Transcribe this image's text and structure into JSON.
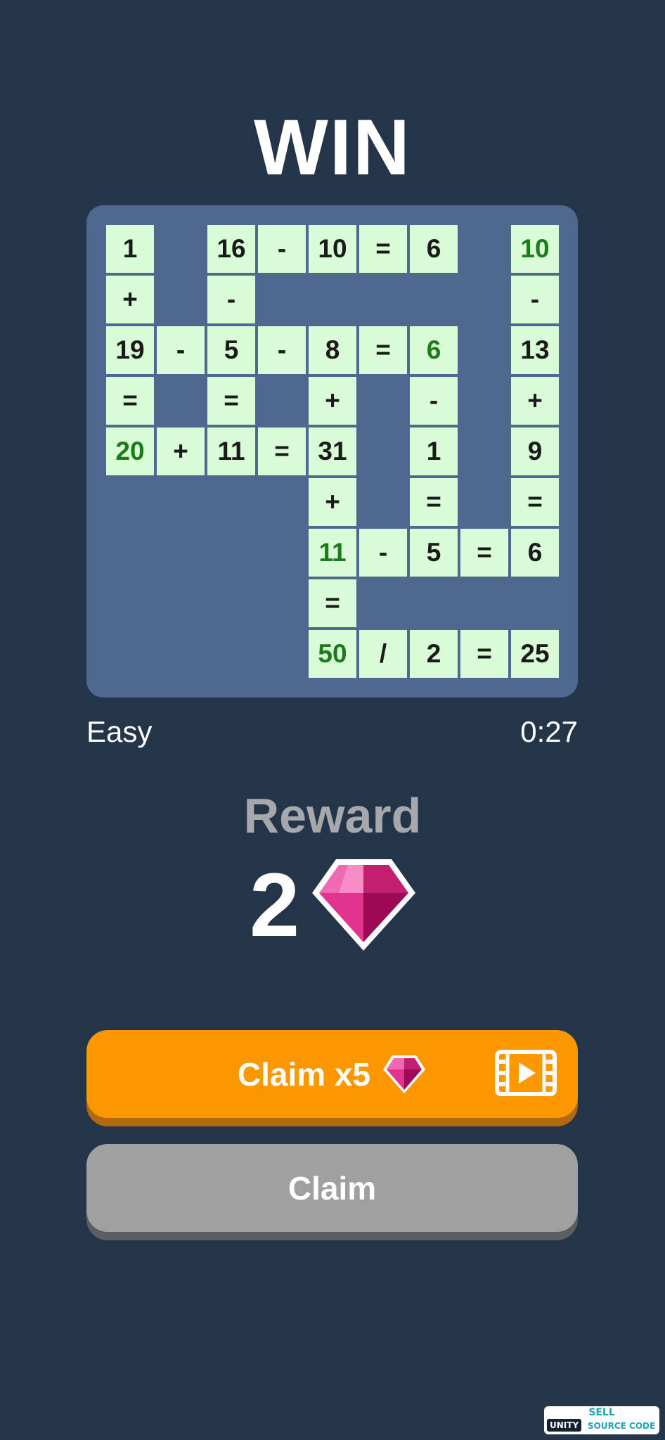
{
  "title": "WIN",
  "puzzle": {
    "cells": [
      {
        "r": 0,
        "c": 0,
        "t": "1"
      },
      {
        "r": 0,
        "c": 2,
        "t": "16"
      },
      {
        "r": 0,
        "c": 3,
        "t": "-"
      },
      {
        "r": 0,
        "c": 4,
        "t": "10"
      },
      {
        "r": 0,
        "c": 5,
        "t": "="
      },
      {
        "r": 0,
        "c": 6,
        "t": "6"
      },
      {
        "r": 0,
        "c": 8,
        "t": "10",
        "answer": true
      },
      {
        "r": 1,
        "c": 0,
        "t": "+"
      },
      {
        "r": 1,
        "c": 2,
        "t": "-"
      },
      {
        "r": 1,
        "c": 8,
        "t": "-"
      },
      {
        "r": 2,
        "c": 0,
        "t": "19"
      },
      {
        "r": 2,
        "c": 1,
        "t": "-"
      },
      {
        "r": 2,
        "c": 2,
        "t": "5"
      },
      {
        "r": 2,
        "c": 3,
        "t": "-"
      },
      {
        "r": 2,
        "c": 4,
        "t": "8"
      },
      {
        "r": 2,
        "c": 5,
        "t": "="
      },
      {
        "r": 2,
        "c": 6,
        "t": "6",
        "answer": true
      },
      {
        "r": 2,
        "c": 8,
        "t": "13"
      },
      {
        "r": 3,
        "c": 0,
        "t": "="
      },
      {
        "r": 3,
        "c": 2,
        "t": "="
      },
      {
        "r": 3,
        "c": 4,
        "t": "+"
      },
      {
        "r": 3,
        "c": 6,
        "t": "-"
      },
      {
        "r": 3,
        "c": 8,
        "t": "+"
      },
      {
        "r": 4,
        "c": 0,
        "t": "20",
        "answer": true
      },
      {
        "r": 4,
        "c": 1,
        "t": "+"
      },
      {
        "r": 4,
        "c": 2,
        "t": "11"
      },
      {
        "r": 4,
        "c": 3,
        "t": "="
      },
      {
        "r": 4,
        "c": 4,
        "t": "31"
      },
      {
        "r": 4,
        "c": 6,
        "t": "1"
      },
      {
        "r": 4,
        "c": 8,
        "t": "9"
      },
      {
        "r": 5,
        "c": 4,
        "t": "+"
      },
      {
        "r": 5,
        "c": 6,
        "t": "="
      },
      {
        "r": 5,
        "c": 8,
        "t": "="
      },
      {
        "r": 6,
        "c": 4,
        "t": "11",
        "answer": true
      },
      {
        "r": 6,
        "c": 5,
        "t": "-"
      },
      {
        "r": 6,
        "c": 6,
        "t": "5"
      },
      {
        "r": 6,
        "c": 7,
        "t": "="
      },
      {
        "r": 6,
        "c": 8,
        "t": "6"
      },
      {
        "r": 7,
        "c": 4,
        "t": "="
      },
      {
        "r": 8,
        "c": 4,
        "t": "50",
        "answer": true
      },
      {
        "r": 8,
        "c": 5,
        "t": "/"
      },
      {
        "r": 8,
        "c": 6,
        "t": "2"
      },
      {
        "r": 8,
        "c": 7,
        "t": "="
      },
      {
        "r": 8,
        "c": 8,
        "t": "25"
      }
    ]
  },
  "status": {
    "difficulty": "Easy",
    "time": "0:27"
  },
  "reward": {
    "label": "Reward",
    "amount": "2",
    "icon": "gem-icon"
  },
  "buttons": {
    "claim_x5": "Claim x5",
    "claim_x5_icons": [
      "gem-icon",
      "video-ad-icon"
    ],
    "claim": "Claim"
  },
  "colors": {
    "background": "#253549",
    "board": "#4e6890",
    "cell": "#d9fbd6",
    "answer_text": "#1b7c1b",
    "claim_x5_button": "#fb9800",
    "claim_button": "#a0a0a0",
    "gem": "#e0348f"
  },
  "watermark": {
    "top": "SELL",
    "left": "UNITY",
    "right": "SOURCE CODE"
  }
}
